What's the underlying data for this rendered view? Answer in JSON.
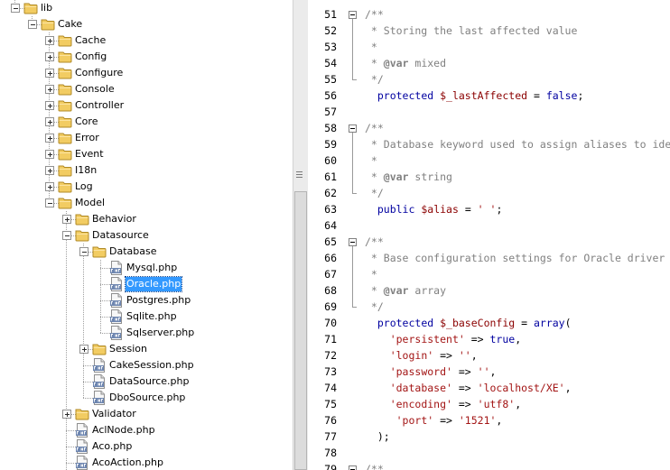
{
  "tree": {
    "selected_index": 17,
    "items": [
      {
        "label": "lib",
        "depth": 0,
        "type": "folder",
        "expander": "minus"
      },
      {
        "label": "Cake",
        "depth": 1,
        "type": "folder",
        "expander": "minus"
      },
      {
        "label": "Cache",
        "depth": 2,
        "type": "folder",
        "expander": "plus"
      },
      {
        "label": "Config",
        "depth": 2,
        "type": "folder",
        "expander": "plus"
      },
      {
        "label": "Configure",
        "depth": 2,
        "type": "folder",
        "expander": "plus"
      },
      {
        "label": "Console",
        "depth": 2,
        "type": "folder",
        "expander": "plus"
      },
      {
        "label": "Controller",
        "depth": 2,
        "type": "folder",
        "expander": "plus"
      },
      {
        "label": "Core",
        "depth": 2,
        "type": "folder",
        "expander": "plus"
      },
      {
        "label": "Error",
        "depth": 2,
        "type": "folder",
        "expander": "plus"
      },
      {
        "label": "Event",
        "depth": 2,
        "type": "folder",
        "expander": "plus"
      },
      {
        "label": "I18n",
        "depth": 2,
        "type": "folder",
        "expander": "plus"
      },
      {
        "label": "Log",
        "depth": 2,
        "type": "folder",
        "expander": "plus"
      },
      {
        "label": "Model",
        "depth": 2,
        "type": "folder",
        "expander": "minus"
      },
      {
        "label": "Behavior",
        "depth": 3,
        "type": "folder",
        "expander": "plus"
      },
      {
        "label": "Datasource",
        "depth": 3,
        "type": "folder",
        "expander": "minus"
      },
      {
        "label": "Database",
        "depth": 4,
        "type": "folder",
        "expander": "minus"
      },
      {
        "label": "Mysql.php",
        "depth": 5,
        "type": "file"
      },
      {
        "label": "Oracle.php",
        "depth": 5,
        "type": "file"
      },
      {
        "label": "Postgres.php",
        "depth": 5,
        "type": "file"
      },
      {
        "label": "Sqlite.php",
        "depth": 5,
        "type": "file"
      },
      {
        "label": "Sqlserver.php",
        "depth": 5,
        "type": "file"
      },
      {
        "label": "Session",
        "depth": 4,
        "type": "folder",
        "expander": "plus"
      },
      {
        "label": "CakeSession.php",
        "depth": 4,
        "type": "file"
      },
      {
        "label": "DataSource.php",
        "depth": 4,
        "type": "file"
      },
      {
        "label": "DboSource.php",
        "depth": 4,
        "type": "file"
      },
      {
        "label": "Validator",
        "depth": 3,
        "type": "folder",
        "expander": "plus"
      },
      {
        "label": "AclNode.php",
        "depth": 3,
        "type": "file"
      },
      {
        "label": "Aco.php",
        "depth": 3,
        "type": "file"
      },
      {
        "label": "AcoAction.php",
        "depth": 3,
        "type": "file"
      }
    ]
  },
  "editor": {
    "lines": [
      {
        "num": "51",
        "fold": "start",
        "tokens": [
          [
            "comment",
            "/**"
          ]
        ]
      },
      {
        "num": "52",
        "fold": "mid",
        "tokens": [
          [
            "comment",
            " * Storing the last affected value"
          ]
        ]
      },
      {
        "num": "53",
        "fold": "mid",
        "tokens": [
          [
            "comment",
            " *"
          ]
        ]
      },
      {
        "num": "54",
        "fold": "mid",
        "tokens": [
          [
            "comment",
            " * "
          ],
          [
            "tag",
            "@var"
          ],
          [
            "comment",
            " mixed"
          ]
        ]
      },
      {
        "num": "55",
        "fold": "end",
        "tokens": [
          [
            "comment",
            " */"
          ]
        ]
      },
      {
        "num": "56",
        "fold": "",
        "tokens": [
          [
            "default",
            "  "
          ],
          [
            "keyword",
            "protected"
          ],
          [
            "default",
            " "
          ],
          [
            "var",
            "$_lastAffected"
          ],
          [
            "default",
            " = "
          ],
          [
            "keyword",
            "false"
          ],
          [
            "default",
            ";"
          ]
        ]
      },
      {
        "num": "57",
        "fold": "",
        "tokens": []
      },
      {
        "num": "58",
        "fold": "start",
        "tokens": [
          [
            "comment",
            "/**"
          ]
        ]
      },
      {
        "num": "59",
        "fold": "mid",
        "tokens": [
          [
            "comment",
            " * Database keyword used to assign aliases to identifiers."
          ]
        ]
      },
      {
        "num": "60",
        "fold": "mid",
        "tokens": [
          [
            "comment",
            " *"
          ]
        ]
      },
      {
        "num": "61",
        "fold": "mid",
        "tokens": [
          [
            "comment",
            " * "
          ],
          [
            "tag",
            "@var"
          ],
          [
            "comment",
            " string"
          ]
        ]
      },
      {
        "num": "62",
        "fold": "end",
        "tokens": [
          [
            "comment",
            " */"
          ]
        ]
      },
      {
        "num": "63",
        "fold": "",
        "tokens": [
          [
            "default",
            "  "
          ],
          [
            "keyword",
            "public"
          ],
          [
            "default",
            " "
          ],
          [
            "var",
            "$alias"
          ],
          [
            "default",
            " = "
          ],
          [
            "string",
            "' '"
          ],
          [
            "default",
            ";"
          ]
        ]
      },
      {
        "num": "64",
        "fold": "",
        "tokens": []
      },
      {
        "num": "65",
        "fold": "start",
        "tokens": [
          [
            "comment",
            "/**"
          ]
        ]
      },
      {
        "num": "66",
        "fold": "mid",
        "tokens": [
          [
            "comment",
            " * Base configuration settings for Oracle driver"
          ]
        ]
      },
      {
        "num": "67",
        "fold": "mid",
        "tokens": [
          [
            "comment",
            " *"
          ]
        ]
      },
      {
        "num": "68",
        "fold": "mid",
        "tokens": [
          [
            "comment",
            " * "
          ],
          [
            "tag",
            "@var"
          ],
          [
            "comment",
            " array"
          ]
        ]
      },
      {
        "num": "69",
        "fold": "end",
        "tokens": [
          [
            "comment",
            " */"
          ]
        ]
      },
      {
        "num": "70",
        "fold": "",
        "tokens": [
          [
            "default",
            "  "
          ],
          [
            "keyword",
            "protected"
          ],
          [
            "default",
            " "
          ],
          [
            "var",
            "$_baseConfig"
          ],
          [
            "default",
            " = "
          ],
          [
            "keyword",
            "array"
          ],
          [
            "default",
            "("
          ]
        ]
      },
      {
        "num": "71",
        "fold": "",
        "tokens": [
          [
            "default",
            "    "
          ],
          [
            "string",
            "'persistent'"
          ],
          [
            "default",
            " => "
          ],
          [
            "keyword",
            "true"
          ],
          [
            "default",
            ","
          ]
        ]
      },
      {
        "num": "72",
        "fold": "",
        "tokens": [
          [
            "default",
            "    "
          ],
          [
            "string",
            "'login'"
          ],
          [
            "default",
            " => "
          ],
          [
            "string",
            "''"
          ],
          [
            "default",
            ","
          ]
        ]
      },
      {
        "num": "73",
        "fold": "",
        "tokens": [
          [
            "default",
            "    "
          ],
          [
            "string",
            "'password'"
          ],
          [
            "default",
            " => "
          ],
          [
            "string",
            "''"
          ],
          [
            "default",
            ","
          ]
        ]
      },
      {
        "num": "74",
        "fold": "",
        "tokens": [
          [
            "default",
            "    "
          ],
          [
            "string",
            "'database'"
          ],
          [
            "default",
            " => "
          ],
          [
            "string",
            "'localhost/XE'"
          ],
          [
            "default",
            ","
          ]
        ]
      },
      {
        "num": "75",
        "fold": "",
        "tokens": [
          [
            "default",
            "    "
          ],
          [
            "string",
            "'encoding'"
          ],
          [
            "default",
            " => "
          ],
          [
            "string",
            "'utf8'"
          ],
          [
            "default",
            ","
          ]
        ]
      },
      {
        "num": "76",
        "fold": "",
        "tokens": [
          [
            "default",
            "     "
          ],
          [
            "string",
            "'port'"
          ],
          [
            "default",
            " => "
          ],
          [
            "string",
            "'1521'"
          ],
          [
            "default",
            ","
          ]
        ]
      },
      {
        "num": "77",
        "fold": "",
        "tokens": [
          [
            "default",
            "  );"
          ]
        ]
      },
      {
        "num": "78",
        "fold": "",
        "tokens": []
      },
      {
        "num": "79",
        "fold": "start",
        "tokens": [
          [
            "comment",
            "/**"
          ]
        ]
      }
    ]
  },
  "icons": {
    "folder": "folder-icon",
    "php_file": "php-file-icon",
    "expand": "plus-expander-icon",
    "collapse": "minus-expander-icon",
    "splitter_grip": "grip-icon"
  },
  "colors": {
    "selection": "#3399ff",
    "comment": "#808080",
    "keyword": "#0000a0",
    "variable": "#8b0000",
    "string": "#a31515",
    "folder": "#f0c85a"
  }
}
